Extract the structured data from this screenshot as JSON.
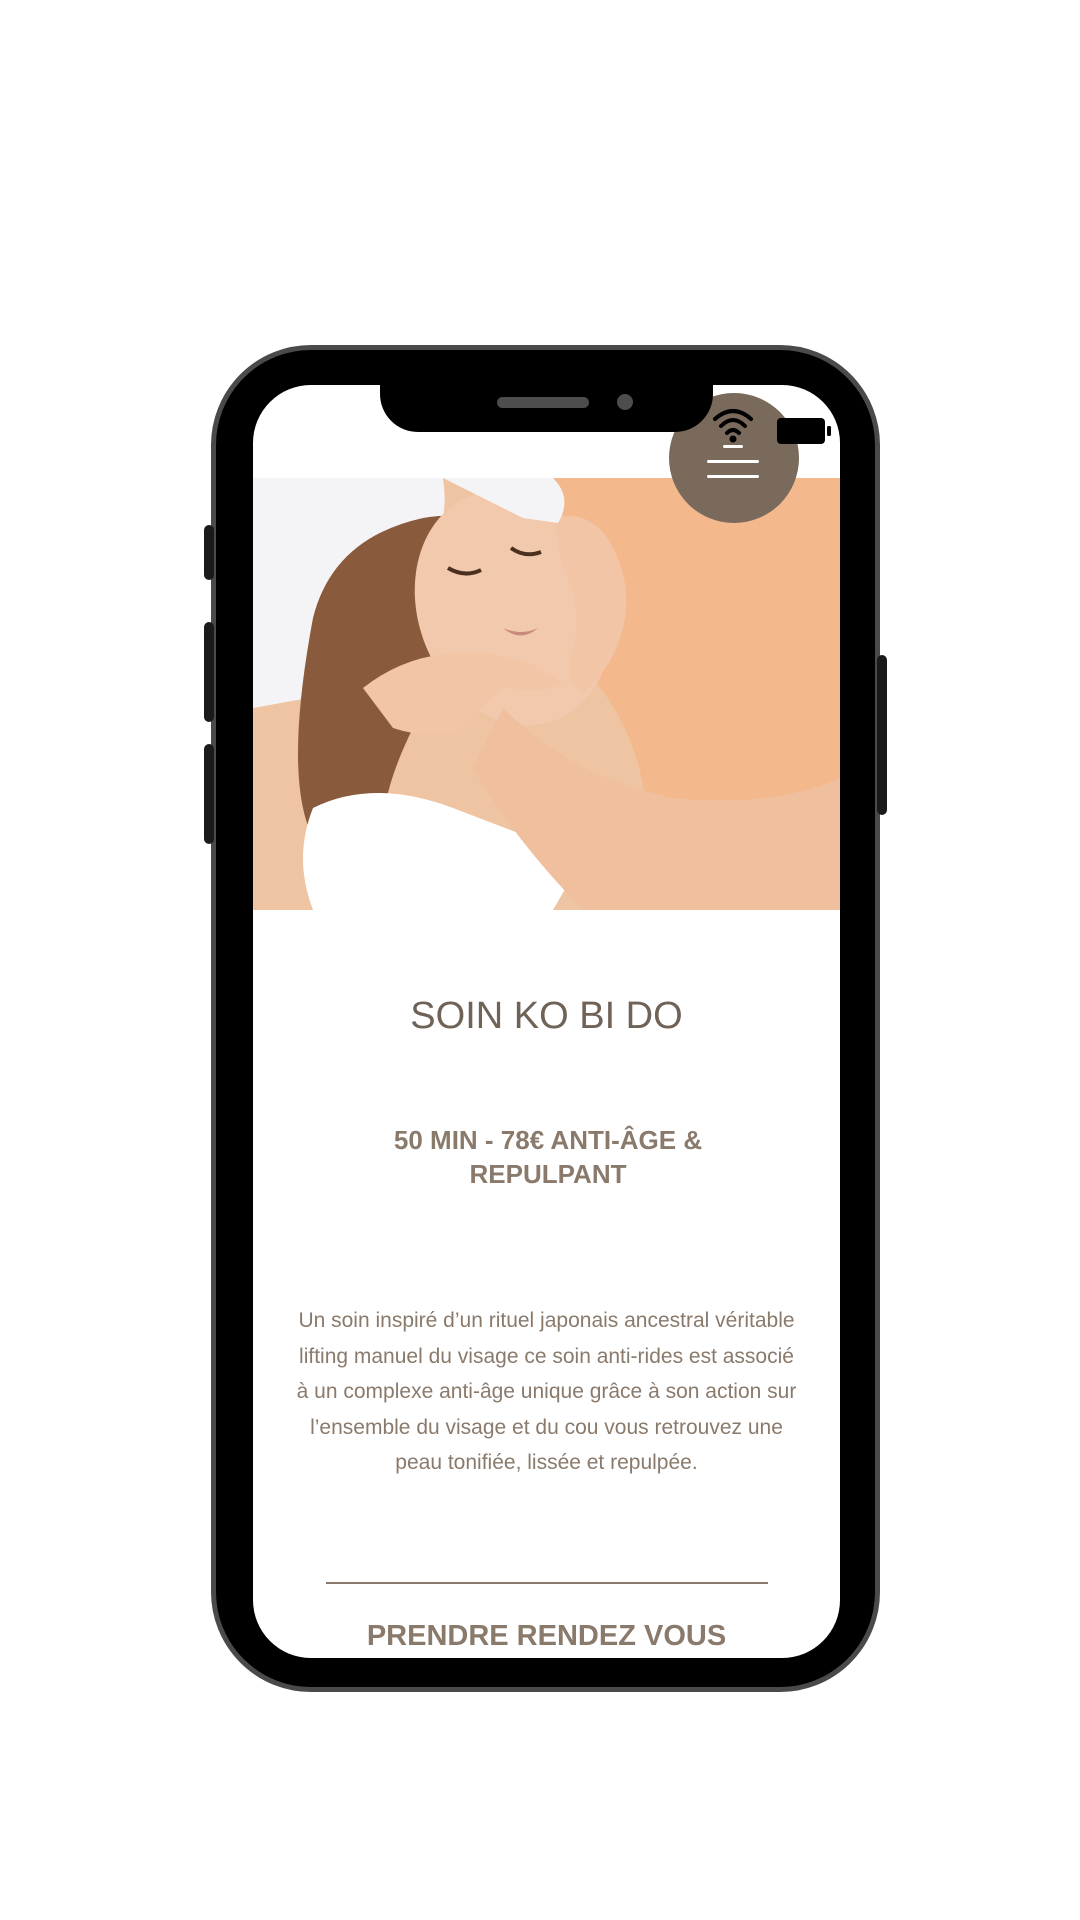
{
  "header": {
    "menu_icon": "hamburger-menu-icon",
    "status_icons": [
      "wifi-icon",
      "battery-icon"
    ]
  },
  "hero": {
    "image": "facial-massage-photo"
  },
  "treatment": {
    "title": "SOIN KO BI DO",
    "subtitle": "50 MIN - 78€ ANTI-ÂGE & REPULPANT",
    "description": "Un soin inspiré d’un rituel japonais ancestral véritable lifting manuel du visage ce soin anti-rides est associé à un complexe anti-âge unique grâce à son action sur l’ensemble du visage et du cou vous retrouvez une peau tonifiée, lissée et repulpée.",
    "cta_label": "PRENDRE RENDEZ VOUS"
  },
  "colors": {
    "accent": "#7a6a5c",
    "text": "#8a7a6c",
    "title": "#6f6257",
    "frame": "#000000"
  }
}
